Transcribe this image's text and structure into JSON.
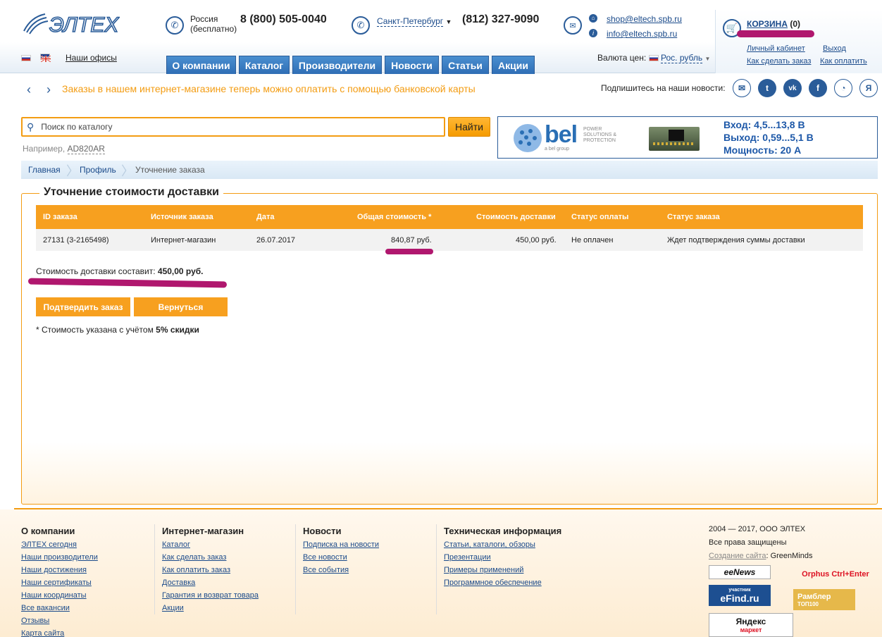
{
  "header": {
    "logo_text": "ЭЛТЕХ",
    "phone1": {
      "region": "Россия",
      "note": "(бесплатно)",
      "number": "8 (800) 505-0040"
    },
    "phone2": {
      "city": "Санкт-Петербург",
      "number": "(812) 327-9090"
    },
    "emails": [
      "shop@eltech.spb.ru",
      "info@eltech.spb.ru"
    ],
    "cart": {
      "label": "КОРЗИНА",
      "count": "(0)"
    },
    "account_links": [
      "Личный кабинет",
      "Выход",
      "Как сделать заказ",
      "Как оплатить"
    ],
    "offices_link": "Наши офисы",
    "currency_label": "Валюта цен:",
    "currency_value": "Рос. рубль"
  },
  "nav": {
    "tabs": [
      "О компании",
      "Каталог",
      "Производители",
      "Новости",
      "Статьи",
      "Акции"
    ]
  },
  "ticker": {
    "message": "Заказы в нашем интернет-магазине теперь можно оплатить с помощью банковской карты",
    "subscribe_label": "Подпишитесь на наши новости:",
    "social_icons": [
      "mail-icon",
      "twitter-icon",
      "vk-icon",
      "facebook-icon",
      "rss-icon",
      "yandex-icon"
    ]
  },
  "search": {
    "placeholder": "Поиск по каталогу",
    "button": "Найти",
    "example_prefix": "Например,",
    "example_value": "AD820AR"
  },
  "banner": {
    "brand": "bel",
    "tagline1": "POWER",
    "tagline2": "SOLUTIONS &",
    "tagline3": "PROTECTION",
    "group": "a bel group",
    "line1": "Вход: 4,5...13,8 В",
    "line2": "Выход: 0,59...5,1 В",
    "line3": "Мощность: 20 А"
  },
  "breadcrumb": [
    "Главная",
    "Профиль",
    "Уточнение заказа"
  ],
  "panel": {
    "title": "Уточнение стоимости доставки",
    "columns": [
      "ID заказа",
      "Источник заказа",
      "Дата",
      "Общая стоимость *",
      "Стоимость доставки",
      "Статус оплаты",
      "Статус заказа"
    ],
    "row": [
      "27131 (3-2165498)",
      "Интернет-магазин",
      "26.07.2017",
      "840,87 руб.",
      "450,00 руб.",
      "Не оплачен",
      "Ждет подтверждения суммы доставки"
    ],
    "delivery_label": "Стоимость доставки составит:",
    "delivery_value": "450,00 руб.",
    "confirm_button": "Подтвердить заказ",
    "back_button": "Вернуться",
    "note_prefix": "* Стоимость указана с учётом",
    "note_bold": "5% скидки"
  },
  "footer": {
    "col1": {
      "title": "О компании",
      "links": [
        "ЭЛТЕХ сегодня",
        "Наши производители",
        "Наши достижения",
        "Наши сертификаты",
        "Наши координаты",
        "Все вакансии",
        "Отзывы",
        "Карта сайта"
      ]
    },
    "col2": {
      "title": "Интернет-магазин",
      "links": [
        "Каталог",
        "Как сделать заказ",
        "Как оплатить заказ",
        "Доставка",
        "Гарантия и возврат товара",
        "Акции"
      ]
    },
    "col3": {
      "title": "Новости",
      "links": [
        "Подписка на новости",
        "Все новости",
        "Все события"
      ]
    },
    "col4": {
      "title": "Техническая информация",
      "links": [
        "Статьи, каталоги, обзоры",
        "Презентации",
        "Примеры применений",
        "Программное обеспечение"
      ]
    },
    "copyright": "2004 — 2017, ООО ЭЛТЕХ",
    "rights": "Все права защищены",
    "created_link": "Создание сайта",
    "created_by": ": GreenMinds",
    "badges": [
      "eeNews",
      "Orphus Ctrl+Enter",
      "участник",
      "eFind.ru",
      "Рамблер",
      "ТОП100",
      "Яндекс",
      "маркет"
    ]
  },
  "colors": {
    "accent": "#f7a01f",
    "brand_blue": "#2a5c99",
    "annotation": "#b0176e"
  }
}
